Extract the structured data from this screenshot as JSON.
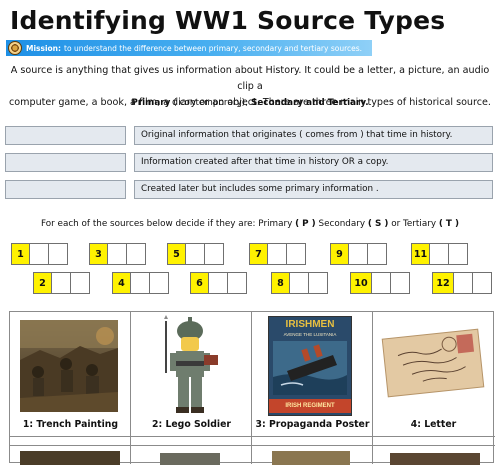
{
  "title": "Identifying WW1 Source Types",
  "mission": {
    "label": "Mission:",
    "text": "to understand the difference between primary, secondary and tertiary sources."
  },
  "intro": {
    "line1": "A source is anything that gives us information about History. It could be a letter, a picture, an audio clip a",
    "line2": "computer game, a book, a film, a diary or an object. There are three main types of historical source."
  },
  "types": {
    "primary": "Primary",
    "primary_note": "( contemporary),",
    "rest": "Secondary and Tertiary."
  },
  "definitions": [
    {
      "answer": "",
      "text": "Original information that originates  ( comes from )  that time in history."
    },
    {
      "answer": "",
      "text": "Information created after that time in history OR a copy."
    },
    {
      "answer": "",
      "text": "Created later but includes some primary information ."
    }
  ],
  "instruction": {
    "lead": "For each of the sources below decide if they are:  Primary",
    "p": "( P )",
    "secondary": "Secondary",
    "s": "( S )",
    "or": "or Tertiary",
    "t": "( T )"
  },
  "question_numbers": [
    "1",
    "2",
    "3",
    "4",
    "5",
    "6",
    "7",
    "8",
    "9",
    "10",
    "11",
    "12"
  ],
  "sources": [
    {
      "caption": "1: Trench Painting"
    },
    {
      "caption": "2: Lego Soldier"
    },
    {
      "caption": "3: Propaganda Poster",
      "poster_title": "IRISHMEN",
      "poster_sub": "AVENGE THE LUSITANIA",
      "poster_bottom": "IRISH REGIMENT"
    },
    {
      "caption": "4: Letter"
    }
  ],
  "colors": {
    "mission_bar": "#1e90e6",
    "answer_box": "#e4e9ef",
    "question_number": "#fff200"
  },
  "icons": [
    "mission-badge-icon"
  ]
}
